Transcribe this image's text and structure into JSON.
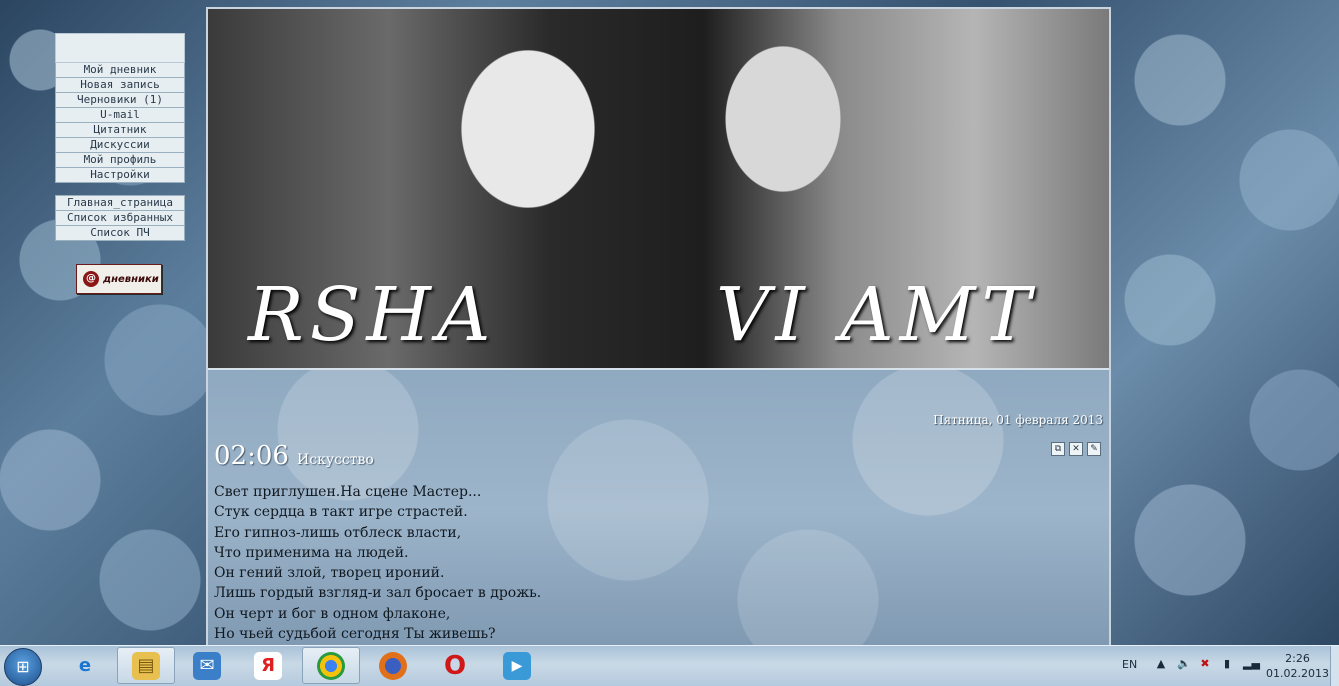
{
  "sidebar": {
    "items": [
      {
        "label": "Мой дневник"
      },
      {
        "label": "Новая запись"
      },
      {
        "label": "Черновики (1)"
      },
      {
        "label": "U-mail"
      },
      {
        "label": "Цитатник"
      },
      {
        "label": "Дискуссии"
      },
      {
        "label": "Мой профиль"
      },
      {
        "label": "Настройки"
      }
    ],
    "items2": [
      {
        "label": "Главная_страница"
      },
      {
        "label": "Список избранных"
      },
      {
        "label": "Список ПЧ"
      }
    ],
    "logo": {
      "text": "дневники",
      "icon": "diary-logo-icon"
    }
  },
  "banner": {
    "left_text": "RSHA",
    "right_text": "VI AMT"
  },
  "post": {
    "date": "Пятница, 01 февраля 2013",
    "time": "02:06",
    "category": "Искусство",
    "icons": [
      "copy-icon",
      "delete-icon",
      "edit-icon"
    ],
    "lines": [
      "Свет приглушен.На сцене Мастер...",
      "Стук сердца в такт игре страстей.",
      "Его гипноз-лишь отблеск власти,",
      "Что применима на людей.",
      "Он гений злой, творец ироний.",
      "Лишь гордый взгляд-и зал бросает в дрожь.",
      "Он черт и бог в одном флаконе,",
      "Но чьей судьбой сегодня Ты живешь?"
    ]
  },
  "taskbar": {
    "apps": [
      {
        "name": "internet-explorer-icon",
        "glyph": "e",
        "color": "#1b76d1"
      },
      {
        "name": "file-explorer-icon",
        "glyph": "▤",
        "color": "#e0b040"
      },
      {
        "name": "mail-icon",
        "glyph": "✉",
        "color": "#3a7fc8"
      },
      {
        "name": "yandex-browser-icon",
        "glyph": "Я",
        "color": "#e02020"
      },
      {
        "name": "chrome-icon",
        "glyph": "◉",
        "color": "#2a9a40"
      },
      {
        "name": "firefox-icon",
        "glyph": "●",
        "color": "#e0701a"
      },
      {
        "name": "opera-icon",
        "glyph": "O",
        "color": "#d01818"
      },
      {
        "name": "media-player-icon",
        "glyph": "▶",
        "color": "#3a9ad8"
      }
    ],
    "language": "EN",
    "time": "2:26",
    "date": "01.02.2013"
  }
}
